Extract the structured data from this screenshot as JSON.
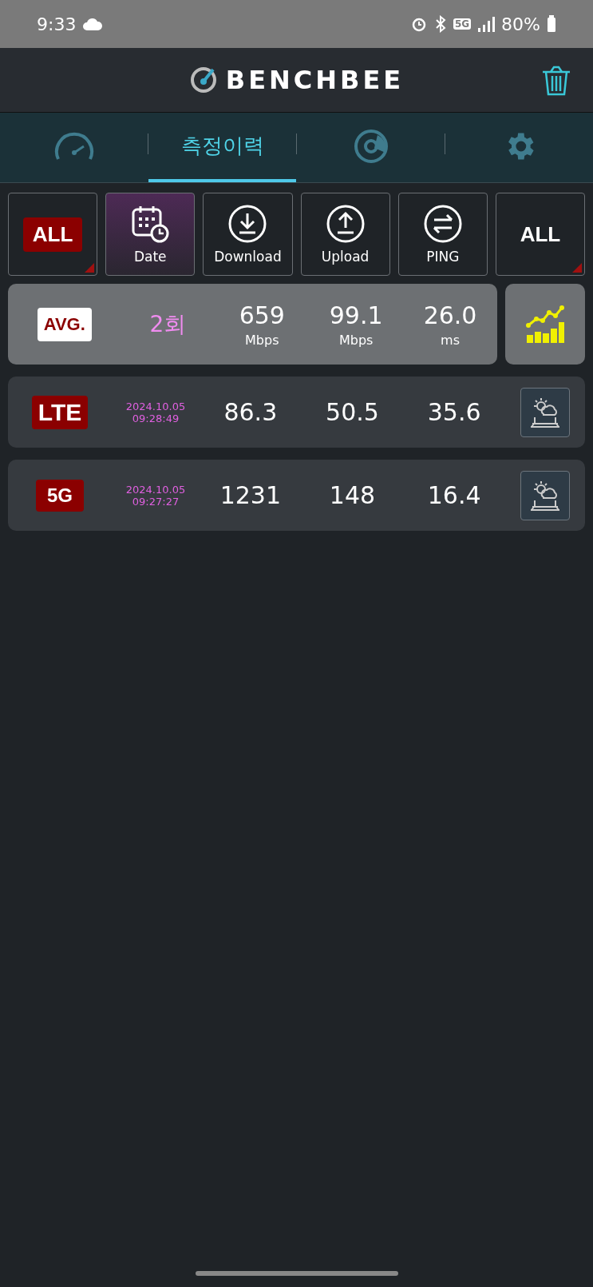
{
  "status_bar": {
    "time": "9:33",
    "network_badge": "5G",
    "battery": "80%"
  },
  "header": {
    "logo": "BENCHBEE"
  },
  "tabs": [
    {
      "kind": "speed",
      "selected": false
    },
    {
      "kind": "label",
      "label": "측정이력",
      "selected": true
    },
    {
      "kind": "chart",
      "selected": false
    },
    {
      "kind": "settings",
      "selected": false
    }
  ],
  "filters": [
    {
      "kind": "network",
      "label": "ALL",
      "selected": false
    },
    {
      "kind": "date",
      "label": "Date",
      "selected": true
    },
    {
      "kind": "download",
      "label": "Download",
      "selected": false
    },
    {
      "kind": "upload",
      "label": "Upload",
      "selected": false
    },
    {
      "kind": "ping",
      "label": "PING",
      "selected": false
    },
    {
      "kind": "plain",
      "label": "ALL",
      "selected": false
    }
  ],
  "average": {
    "label": "AVG.",
    "count": "2회",
    "download": "659",
    "download_unit": "Mbps",
    "upload": "99.1",
    "upload_unit": "Mbps",
    "ping": "26.0",
    "ping_unit": "ms"
  },
  "results": [
    {
      "network": "LTE",
      "date": "2024.10.05",
      "time": "09:28:49",
      "download": "86.3",
      "upload": "50.5",
      "ping": "35.6"
    },
    {
      "network": "5G",
      "date": "2024.10.05",
      "time": "09:27:27",
      "download": "1231",
      "upload": "148",
      "ping": "16.4"
    }
  ]
}
